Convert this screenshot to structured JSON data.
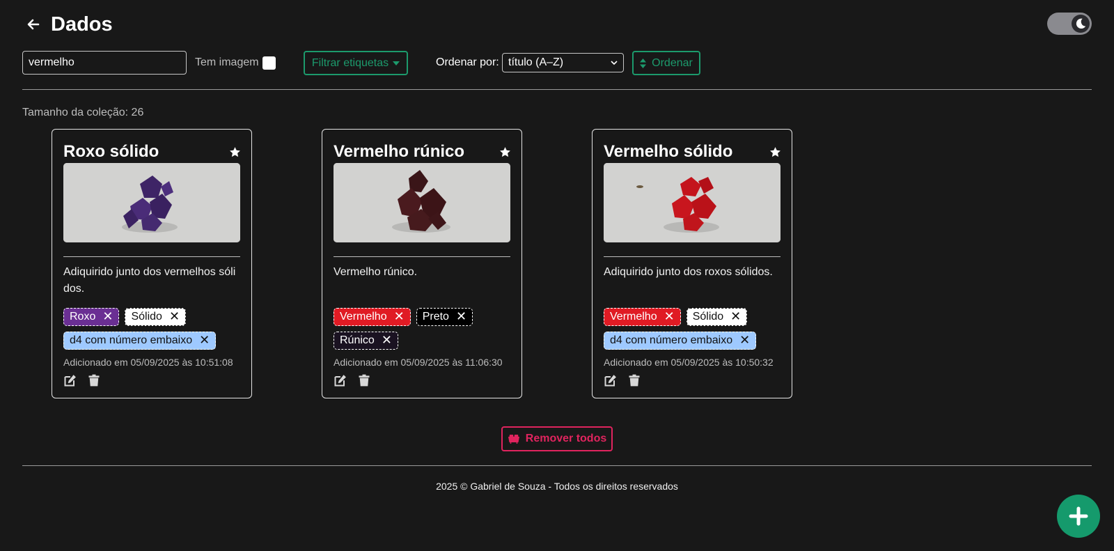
{
  "header": {
    "title": "Dados"
  },
  "toolbar": {
    "search_value": "vermelho",
    "has_image_label": "Tem imagem",
    "filter_label": "Filtrar etiquetas",
    "sort_label": "Ordenar por:",
    "sort_selected": "título (A–Z)",
    "sort_button": "Ordenar"
  },
  "collection": {
    "size_text": "Tamanho da coleção: 26"
  },
  "cards": [
    {
      "title": "Roxo sólido",
      "description": "Adiquirido junto dos vermelhos sólidos.",
      "tags": [
        {
          "label": "Roxo",
          "bg": "#6a2f93",
          "fg": "#ffffff",
          "x": "#ffffff"
        },
        {
          "label": "Sólido",
          "bg": "#ffffff",
          "fg": "#111111",
          "x": "#111111"
        },
        {
          "label": "d4 com número embaixo",
          "bg": "#9ec9ff",
          "fg": "#111111",
          "x": "#111111"
        }
      ],
      "date": "Adicionado em 05/09/2025 às 10:51:08"
    },
    {
      "title": "Vermelho rúnico",
      "description": "Vermelho rúnico.",
      "tags": [
        {
          "label": "Vermelho",
          "bg": "#e01b24",
          "fg": "#ffffff",
          "x": "#ffffff"
        },
        {
          "label": "Preto",
          "bg": "#000000",
          "fg": "#ffffff",
          "x": "#ffffff"
        },
        {
          "label": "Rúnico",
          "bg": "#1a1221",
          "fg": "#ffffff",
          "x": "#ffffff"
        }
      ],
      "date": "Adicionado em 05/09/2025 às 11:06:30"
    },
    {
      "title": "Vermelho sólido",
      "description": "Adiquirido junto dos roxos sólidos.",
      "tags": [
        {
          "label": "Vermelho",
          "bg": "#e01b24",
          "fg": "#ffffff",
          "x": "#ffffff"
        },
        {
          "label": "Sólido",
          "bg": "#ffffff",
          "fg": "#111111",
          "x": "#111111"
        },
        {
          "label": "d4 com número embaixo",
          "bg": "#9ec9ff",
          "fg": "#111111",
          "x": "#111111"
        }
      ],
      "date": "Adicionado em 05/09/2025 às 10:50:32"
    }
  ],
  "remove_all_label": "Remover todos",
  "footer_text": "2025 © Gabriel de Souza - Todos os direitos reservados",
  "colors": {
    "accent": "#1c9a6c",
    "danger": "#e0245e",
    "background": "#181818"
  },
  "icons": {
    "back": "arrow-left-icon",
    "theme": "moon-icon",
    "filter": "caret-down-icon",
    "sort": "sort-icon",
    "favorite": "star-icon",
    "edit": "edit-icon",
    "delete": "trash-icon",
    "remove_all": "dumpster-icon",
    "add": "plus-icon"
  }
}
